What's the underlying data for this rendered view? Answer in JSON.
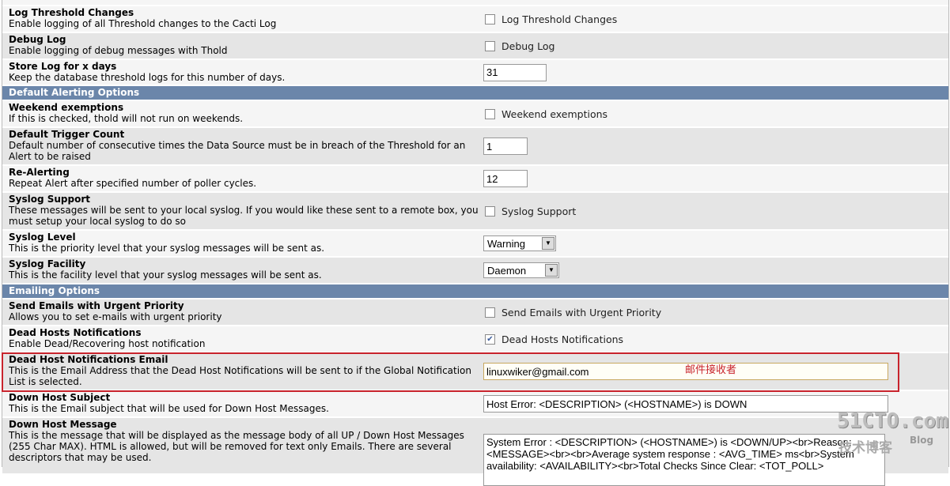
{
  "rows_top": [
    {
      "title": "Log Threshold Changes",
      "desc": "Enable logging of all Threshold changes to the Cacti Log",
      "checkbox": "Log Threshold Changes",
      "checked": false
    },
    {
      "title": "Debug Log",
      "desc": "Enable logging of debug messages with Thold",
      "checkbox": "Debug Log",
      "checked": false
    },
    {
      "title": "Store Log for x days",
      "desc": "Keep the database threshold logs for this number of days.",
      "value": "31"
    }
  ],
  "section_alerting": "Default Alerting Options",
  "alerting": [
    {
      "title": "Weekend exemptions",
      "desc": "If this is checked, thold will not run on weekends.",
      "checkbox": "Weekend exemptions",
      "checked": false
    },
    {
      "title": "Default Trigger Count",
      "desc": "Default number of consecutive times the Data Source must be in breach of the Threshold for an Alert to be raised",
      "value": "1"
    },
    {
      "title": "Re-Alerting",
      "desc": "Repeat Alert after specified number of poller cycles.",
      "value": "12"
    },
    {
      "title": "Syslog Support",
      "desc": "These messages will be sent to your local syslog. If you would like these sent to a remote box, you must setup your local syslog to do so",
      "checkbox": "Syslog Support",
      "checked": false
    },
    {
      "title": "Syslog Level",
      "desc": "This is the priority level that your syslog messages will be sent as.",
      "select": "Warning"
    },
    {
      "title": "Syslog Facility",
      "desc": "This is the facility level that your syslog messages will be sent as.",
      "select": "Daemon"
    }
  ],
  "section_email": "Emailing Options",
  "email": [
    {
      "title": "Send Emails with Urgent Priority",
      "desc": "Allows you to set e-mails with urgent priority",
      "checkbox": "Send Emails with Urgent Priority",
      "checked": false
    },
    {
      "title": "Dead Hosts Notifications",
      "desc": "Enable Dead/Recovering host notification",
      "checkbox": "Dead Hosts Notifications",
      "checked": true
    },
    {
      "title": "Dead Host Notifications Email",
      "desc": "This is the Email Address that the Dead Host Notifications will be sent to if the Global Notification List is selected.",
      "value": "linuxwiker@gmail.com"
    },
    {
      "title": "Down Host Subject",
      "desc": "This is the Email subject that will be used for Down Host Messages.",
      "value": "Host Error: <DESCRIPTION> (<HOSTNAME>) is DOWN"
    },
    {
      "title": "Down Host Message",
      "desc": "This is the message that will be displayed as the message body of all UP / Down Host Messages (255 Char MAX). HTML is allowed, but will be removed for text only Emails. There are several descriptors that may be used.",
      "text": "System Error : <DESCRIPTION> (<HOSTNAME>) is <DOWN/UP><br>Reason: <MESSAGE><br><br>Average system response : <AVG_TIME> ms<br>System availability: <AVAILABILITY><br>Total Checks Since Clear: <TOT_POLL>"
    }
  ],
  "annotation": "邮件接收者",
  "watermark": {
    "line1": "51CTO.com",
    "line2": "技术博客",
    "line3": "Blog"
  },
  "colors": {
    "section_header": "#6b86aa",
    "highlight": "#c8232c"
  }
}
